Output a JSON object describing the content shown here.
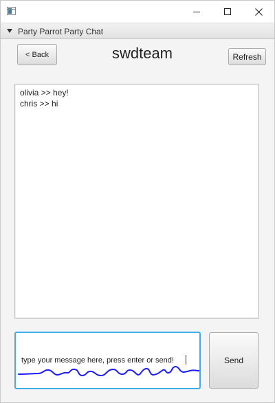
{
  "window": {
    "pane_title": "Party Parrot Party Chat"
  },
  "header": {
    "back_label": "< Back",
    "channel": "swdteam",
    "refresh_label": "Refresh"
  },
  "messages": [
    {
      "user": "olivia",
      "text": "hey!"
    },
    {
      "user": "chris",
      "text": "hi"
    }
  ],
  "composer": {
    "placeholder": "type your message here, press enter or send!",
    "send_label": "Send",
    "focus_color": "#3daee9",
    "annotation_color": "#1a1aff"
  }
}
